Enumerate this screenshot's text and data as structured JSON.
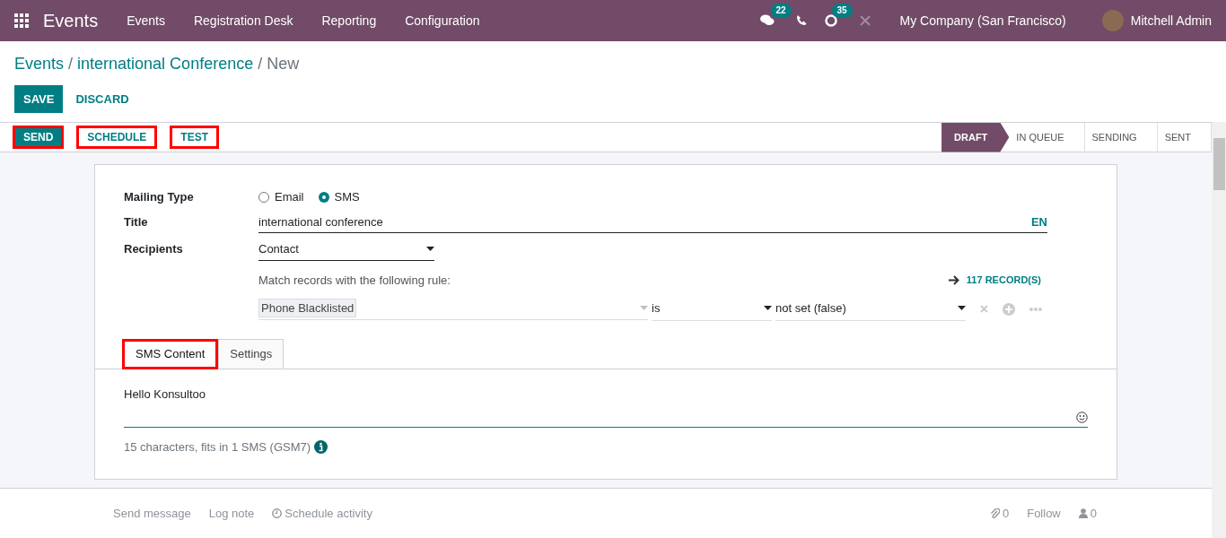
{
  "navbar": {
    "app_title": "Events",
    "menu": [
      "Events",
      "Registration Desk",
      "Reporting",
      "Configuration"
    ],
    "messages_count": "22",
    "activities_count": "35",
    "company": "My Company (San Francisco)",
    "user": "Mitchell Admin"
  },
  "breadcrumb": {
    "links": [
      "Events",
      "international Conference"
    ],
    "separator": "/",
    "current": "New"
  },
  "buttons": {
    "save": "SAVE",
    "discard": "DISCARD"
  },
  "actions": [
    {
      "label": "SEND",
      "kind": "primary",
      "highlighted": true
    },
    {
      "label": "SCHEDULE",
      "kind": "secondary",
      "highlighted": true
    },
    {
      "label": "TEST",
      "kind": "secondary",
      "highlighted": true
    }
  ],
  "stages": [
    {
      "label": "DRAFT",
      "selected": true
    },
    {
      "label": "IN QUEUE",
      "selected": false
    },
    {
      "label": "SENDING",
      "selected": false
    },
    {
      "label": "SENT",
      "selected": false
    }
  ],
  "form": {
    "mailing_type_label": "Mailing Type",
    "mailing_types": [
      {
        "label": "Email",
        "selected": false
      },
      {
        "label": "SMS",
        "selected": true
      }
    ],
    "title_label": "Title",
    "title_value": "international conference",
    "language": "EN",
    "recipients_label": "Recipients",
    "recipients_value": "Contact",
    "rule_text": "Match records with the following rule:",
    "records": "117 RECORD(S)",
    "rule": {
      "field": "Phone Blacklisted",
      "operator": "is",
      "value": "not set (false)"
    }
  },
  "tabs": [
    {
      "label": "SMS Content",
      "selected": true,
      "highlighted": true
    },
    {
      "label": "Settings",
      "selected": false,
      "highlighted": false
    }
  ],
  "sms": {
    "body": "Hello Konsultoo",
    "info": "15 characters, fits in 1 SMS (GSM7)"
  },
  "chatter": {
    "send_message": "Send message",
    "log_note": "Log note",
    "schedule_activity": "Schedule activity",
    "attachments": "0",
    "follow": "Follow",
    "followers": "0"
  }
}
